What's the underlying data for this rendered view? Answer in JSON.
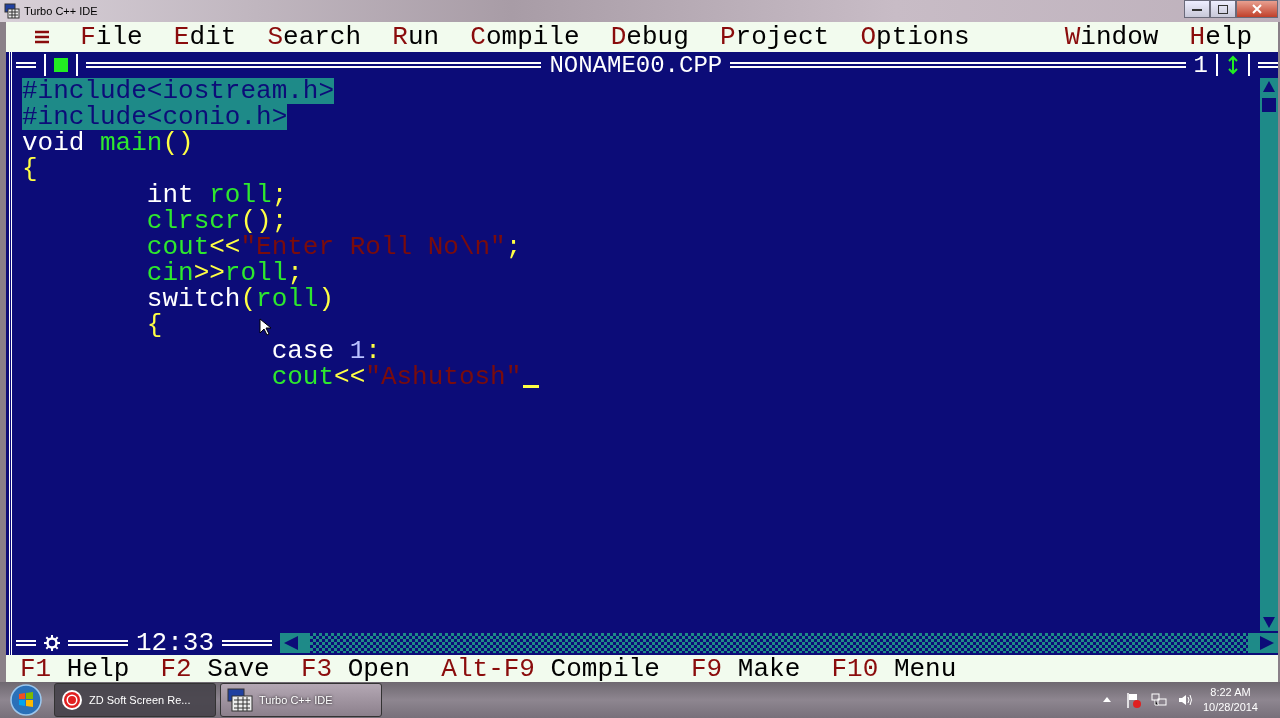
{
  "window": {
    "title": "Turbo C++ IDE"
  },
  "menu": [
    {
      "hot": "F",
      "rest": "ile"
    },
    {
      "hot": "E",
      "rest": "dit"
    },
    {
      "hot": "S",
      "rest": "earch"
    },
    {
      "hot": "R",
      "rest": "un"
    },
    {
      "hot": "C",
      "rest": "ompile"
    },
    {
      "hot": "D",
      "rest": "ebug"
    },
    {
      "hot": "P",
      "rest": "roject"
    },
    {
      "hot": "O",
      "rest": "ptions"
    },
    {
      "hot": "W",
      "rest": "indow"
    },
    {
      "hot": "H",
      "rest": "elp"
    }
  ],
  "editor": {
    "title": "NONAME00.CPP",
    "window_number": "1",
    "position": "12:33",
    "lines": [
      {
        "selected": true,
        "cursor": false,
        "tokens": [
          {
            "kind": "text",
            "text": "#include<iostream.h>"
          }
        ]
      },
      {
        "selected": true,
        "cursor": false,
        "tokens": [
          {
            "kind": "text",
            "text": "#include<conio.h>"
          }
        ]
      },
      {
        "selected": false,
        "cursor": false,
        "tokens": [
          {
            "kind": "keyword",
            "text": "void "
          },
          {
            "kind": "ident",
            "text": "main"
          },
          {
            "kind": "punct",
            "text": "()"
          }
        ]
      },
      {
        "selected": false,
        "cursor": false,
        "tokens": [
          {
            "kind": "punct",
            "text": "{"
          }
        ]
      },
      {
        "selected": false,
        "cursor": false,
        "tokens": [
          {
            "kind": "keyword",
            "text": "        int "
          },
          {
            "kind": "ident",
            "text": "roll"
          },
          {
            "kind": "punct",
            "text": ";"
          }
        ]
      },
      {
        "selected": false,
        "cursor": false,
        "tokens": [
          {
            "kind": "ident",
            "text": "        clrscr"
          },
          {
            "kind": "punct",
            "text": "();"
          }
        ]
      },
      {
        "selected": false,
        "cursor": false,
        "tokens": [
          {
            "kind": "ident",
            "text": "        cout"
          },
          {
            "kind": "punct",
            "text": "<<"
          },
          {
            "kind": "string",
            "text": "\"Enter Roll No\\n\""
          },
          {
            "kind": "punct",
            "text": ";"
          }
        ]
      },
      {
        "selected": false,
        "cursor": false,
        "tokens": [
          {
            "kind": "ident",
            "text": "        cin"
          },
          {
            "kind": "punct",
            "text": ">>"
          },
          {
            "kind": "ident",
            "text": "roll"
          },
          {
            "kind": "punct",
            "text": ";"
          }
        ]
      },
      {
        "selected": false,
        "cursor": false,
        "tokens": [
          {
            "kind": "keyword",
            "text": "        switch"
          },
          {
            "kind": "punct",
            "text": "("
          },
          {
            "kind": "ident",
            "text": "roll"
          },
          {
            "kind": "punct",
            "text": ")"
          }
        ]
      },
      {
        "selected": false,
        "cursor": false,
        "tokens": [
          {
            "kind": "punct",
            "text": "        {"
          }
        ]
      },
      {
        "selected": false,
        "cursor": false,
        "tokens": [
          {
            "kind": "keyword",
            "text": "                case "
          },
          {
            "kind": "number",
            "text": "1"
          },
          {
            "kind": "punct",
            "text": ":"
          }
        ]
      },
      {
        "selected": false,
        "cursor": true,
        "tokens": [
          {
            "kind": "ident",
            "text": "                cout"
          },
          {
            "kind": "punct",
            "text": "<<"
          },
          {
            "kind": "string",
            "text": "\"Ashutosh\""
          }
        ]
      }
    ]
  },
  "status_bar": [
    {
      "key": "F1",
      "label": "Help"
    },
    {
      "key": "F2",
      "label": "Save"
    },
    {
      "key": "F3",
      "label": "Open"
    },
    {
      "key": "Alt-F9",
      "label": "Compile"
    },
    {
      "key": "F9",
      "label": "Make"
    },
    {
      "key": "F10",
      "label": "Menu"
    }
  ],
  "taskbar": {
    "tasks": [
      {
        "label": "ZD Soft Screen Re...",
        "kind": "recorder",
        "selected": false
      },
      {
        "label": "Turbo C++ IDE",
        "kind": "ide",
        "selected": true
      }
    ],
    "time": "8:22 AM",
    "date": "10/28/2014"
  }
}
